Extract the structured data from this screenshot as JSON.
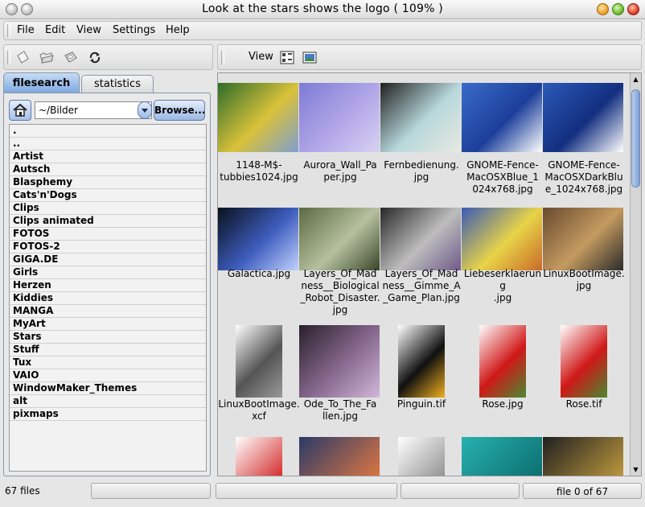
{
  "window": {
    "title": "Look at the stars shows the logo ( 109% )"
  },
  "menu": {
    "items": [
      "File",
      "Edit",
      "View",
      "Settings",
      "Help"
    ]
  },
  "toolbar": {
    "icons": [
      "new-file-icon",
      "open-folder-icon",
      "save-icon",
      "refresh-icon"
    ],
    "view_label": "View",
    "view_icons": [
      "view-mode-icon",
      "image-view-icon"
    ]
  },
  "left": {
    "tabs": [
      "filesearch",
      "statistics"
    ],
    "active_tab": "filesearch",
    "path": "~/Bilder",
    "browse_label": "Browse...",
    "dirs": [
      ".",
      "..",
      "Artist",
      "Autsch",
      "Blasphemy",
      "Cats'n'Dogs",
      "Clips",
      "Clips animated",
      "FOTOS",
      "FOTOS-2",
      "GIGA.DE",
      "Girls",
      "Herzen",
      "Kiddies",
      "MANGA",
      "MyArt",
      "Stars",
      "Stuff",
      "Tux",
      "VAIO",
      "WindowMaker_Themes",
      "alt",
      "pixmaps"
    ]
  },
  "thumbnails": [
    {
      "name": "1148-M$-tubbies1024.jpg",
      "lines": [
        "1148-M$-",
        "tubbies1024.jpg"
      ],
      "colors": [
        "#2f6c2a",
        "#d9c23a",
        "#7f9ed0"
      ]
    },
    {
      "name": "Aurora_Wall_Paper.jpg",
      "lines": [
        "Aurora_Wall_Pa",
        "per.jpg"
      ],
      "colors": [
        "#7e7bd6",
        "#b3a7e8",
        "#d7d2f2"
      ]
    },
    {
      "name": "Fernbedienung.jpg",
      "lines": [
        "Fernbedienung.",
        "jpg"
      ],
      "colors": [
        "#202020",
        "#b8d8dc",
        "#e8e8e0"
      ]
    },
    {
      "name": "GNOME-Fence-MacOSXBlue_1024x768.jpg",
      "lines": [
        "GNOME-Fence-",
        "MacOSXBlue_1",
        "024x768.jpg"
      ],
      "colors": [
        "#3a6cc8",
        "#1c3f9a",
        "#ffffff"
      ]
    },
    {
      "name": "GNOME-Fence-MacOSXDarkBlue_1024x768.jpg",
      "lines": [
        "GNOME-Fence-",
        "MacOSXDarkBlu",
        "e_1024x768.jpg"
      ],
      "colors": [
        "#2c5ab8",
        "#132f80",
        "#ffffff"
      ]
    },
    {
      "name": "Galactica.jpg",
      "lines": [
        "Galactica.jpg"
      ],
      "colors": [
        "#08101c",
        "#3e5dbe",
        "#c2d2ff"
      ]
    },
    {
      "name": "Layers_Of_Madness__Biological_Robot_Disaster.jpg",
      "lines": [
        "Layers_Of_Mad",
        "ness__Biological",
        "_Robot_Disaster.",
        "jpg"
      ],
      "colors": [
        "#5a6a40",
        "#b6c0a0",
        "#3a4428"
      ]
    },
    {
      "name": "Layers_Of_Madness__Gimme_A_Game_Plan.jpg",
      "lines": [
        "Layers_Of_Mad",
        "ness__Gimme_A",
        "_Game_Plan.jpg"
      ],
      "colors": [
        "#282828",
        "#bdbdbd",
        "#6e5a8a"
      ]
    },
    {
      "name": "Liebeserklaerung.jpg",
      "lines": [
        "Liebeserklaerung",
        ".jpg"
      ],
      "colors": [
        "#3a5ab4",
        "#e8d448",
        "#c86a2a"
      ]
    },
    {
      "name": "LinuxBootImage.jpg",
      "lines": [
        "LinuxBootImage.",
        "jpg"
      ],
      "colors": [
        "#6a4a30",
        "#c49a60",
        "#2a2a2a"
      ]
    },
    {
      "name": "LinuxBootImage.xcf",
      "lines": [
        "LinuxBootImage.",
        "xcf"
      ],
      "colors": [
        "#ffffff",
        "#555555",
        "#999999"
      ]
    },
    {
      "name": "Ode_To_The_Fallen.jpg",
      "lines": [
        "Ode_To_The_Fa",
        "llen.jpg"
      ],
      "colors": [
        "#28202c",
        "#8a6a90",
        "#d0b8d8"
      ]
    },
    {
      "name": "Pinguin.tif",
      "lines": [
        "Pinguin.tif"
      ],
      "colors": [
        "#ffffff",
        "#101010",
        "#f0b020"
      ]
    },
    {
      "name": "Rose.jpg",
      "lines": [
        "Rose.jpg"
      ],
      "colors": [
        "#ffffff",
        "#d01818",
        "#4a8a30"
      ]
    },
    {
      "name": "Rose.tif",
      "lines": [
        "Rose.tif"
      ],
      "colors": [
        "#ffffff",
        "#d01818",
        "#4a8a30"
      ]
    }
  ],
  "partial_row_colors": [
    [
      "#ffffff",
      "#d01818"
    ],
    [
      "#2a3a68",
      "#e87a40"
    ],
    [
      "#ffffff",
      "#888888"
    ],
    [
      "#28b0b0",
      "#0a6a6a"
    ],
    [
      "#202020",
      "#c8a040"
    ]
  ],
  "status": {
    "files": "67 files",
    "position": "file 0 of 67"
  },
  "colors": {
    "accent": "#7ea9e0",
    "background": "#e6e6e6"
  }
}
